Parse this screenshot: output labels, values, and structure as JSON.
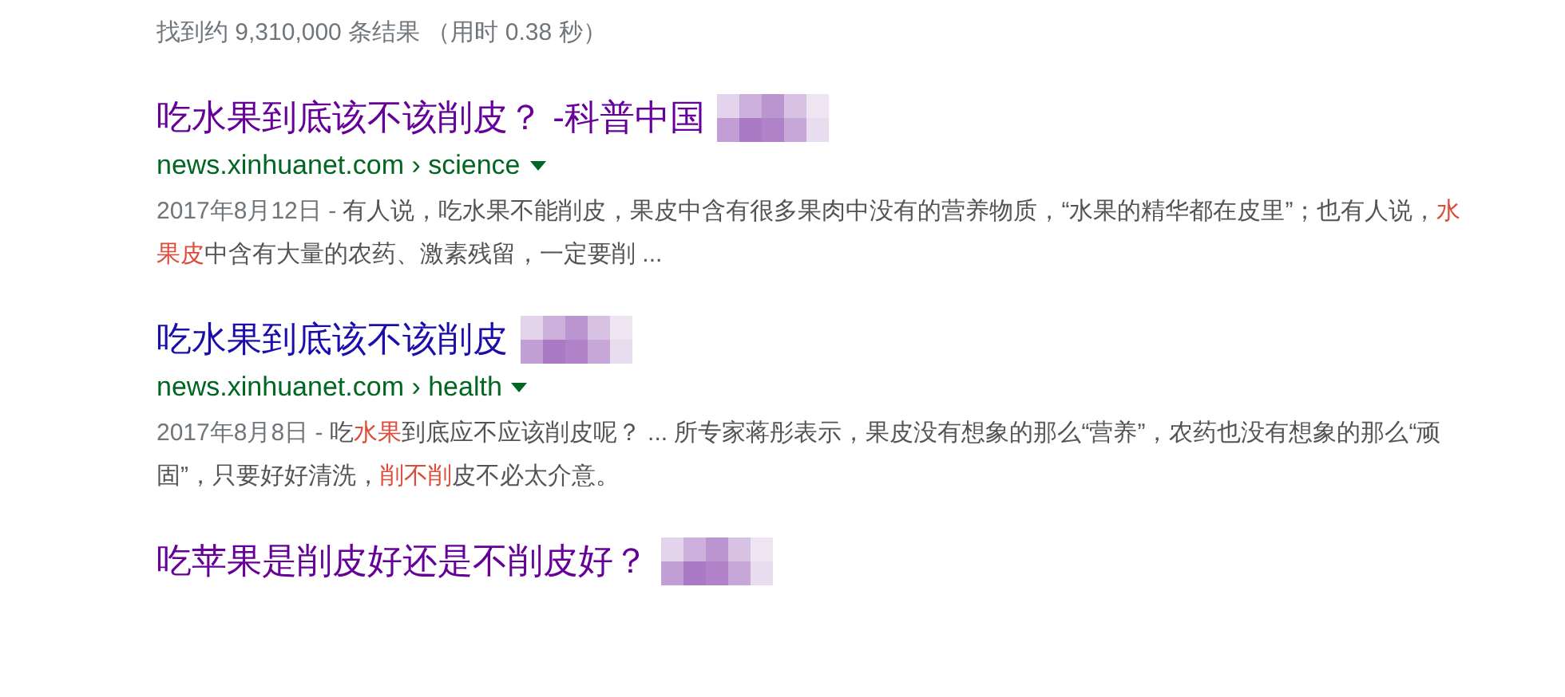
{
  "stats": "找到约 9,310,000 条结果 （用时 0.38 秒）",
  "results": [
    {
      "title": "吃水果到底该不该削皮？ -科普中国",
      "visited": true,
      "url": "news.xinhuanet.com › science",
      "date": "2017年8月12日 - ",
      "snippet": [
        {
          "text": "有人说，吃水果不能削皮，果皮中含有很多果肉中没有的营养物质，“水果的精华都在皮里”；也有人说，",
          "highlight": false
        },
        {
          "text": "水果皮",
          "highlight": true
        },
        {
          "text": "中含有大量的农药、激素残留，一定要削 ...",
          "highlight": false
        }
      ]
    },
    {
      "title": "吃水果到底该不该削皮",
      "visited": false,
      "url": "news.xinhuanet.com › health",
      "date": "2017年8月8日 - ",
      "snippet": [
        {
          "text": "吃",
          "highlight": false
        },
        {
          "text": "水果",
          "highlight": true
        },
        {
          "text": "到底应不应该削皮呢？ ... 所专家蒋彤表示，果皮没有想象的那么“营养”，农药也没有想象的那么“顽固”，只要好好清洗，",
          "highlight": false
        },
        {
          "text": "削不削",
          "highlight": true
        },
        {
          "text": "皮不必太介意。",
          "highlight": false
        }
      ]
    },
    {
      "title": "吃苹果是削皮好还是不削皮好？",
      "visited": true
    }
  ]
}
